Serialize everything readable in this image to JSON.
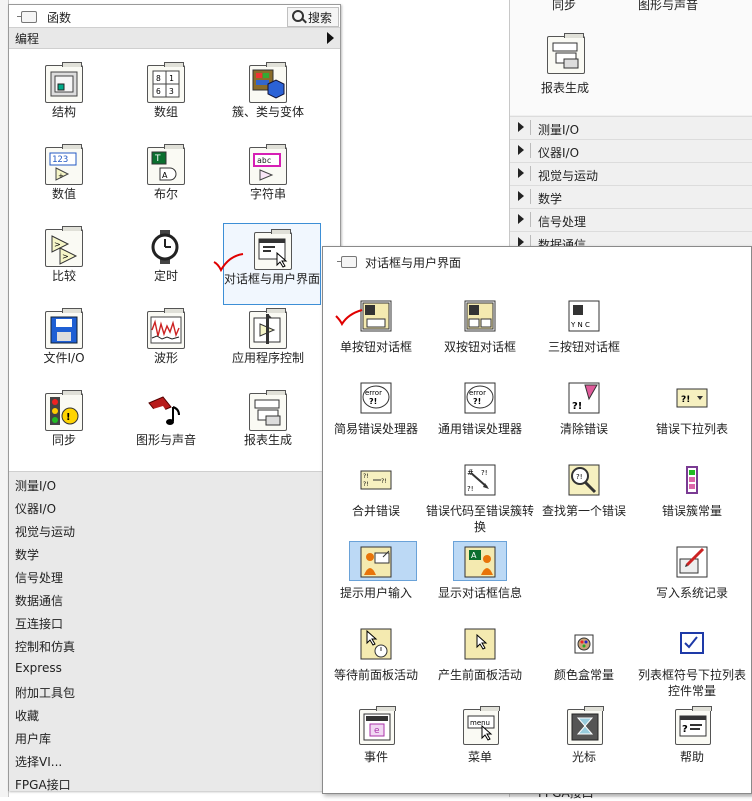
{
  "palette": {
    "title": "函数",
    "search_label": "搜索",
    "category": "编程",
    "items": [
      {
        "label": "结构",
        "icon": "structures-icon"
      },
      {
        "label": "数组",
        "icon": "array-icon"
      },
      {
        "label": "簇、类与变体",
        "icon": "cluster-class-variant-icon"
      },
      {
        "label": "数值",
        "icon": "numeric-icon"
      },
      {
        "label": "布尔",
        "icon": "boolean-icon"
      },
      {
        "label": "字符串",
        "icon": "string-icon"
      },
      {
        "label": "比较",
        "icon": "comparison-icon"
      },
      {
        "label": "定时",
        "icon": "timing-icon"
      },
      {
        "label": "对话框与用户界面",
        "icon": "dialog-ui-icon"
      },
      {
        "label": "文件I/O",
        "icon": "file-io-icon"
      },
      {
        "label": "波形",
        "icon": "waveform-icon"
      },
      {
        "label": "应用程序控制",
        "icon": "application-control-icon"
      },
      {
        "label": "同步",
        "icon": "synchronization-icon"
      },
      {
        "label": "图形与声音",
        "icon": "graphics-sound-icon"
      },
      {
        "label": "报表生成",
        "icon": "report-generation-icon"
      }
    ],
    "categories": [
      "测量I/O",
      "仪器I/O",
      "视觉与运动",
      "数学",
      "信号处理",
      "数据通信",
      "互连接口",
      "控制和仿真",
      "Express",
      "附加工具包",
      "收藏",
      "用户库",
      "选择VI...",
      "FPGA接口"
    ]
  },
  "background_panel": {
    "top_labels": [
      "同步",
      "图形与声音"
    ],
    "item_label": "报表生成",
    "categories": [
      "测量I/O",
      "仪器I/O",
      "视觉与运动",
      "数学",
      "信号处理",
      "数据通信"
    ],
    "bottom_label": "FPGA接口"
  },
  "popup": {
    "title": "对话框与用户界面",
    "items": [
      {
        "label": "单按钮对话框"
      },
      {
        "label": "双按钮对话框"
      },
      {
        "label": "三按钮对话框"
      },
      {
        "label": ""
      },
      {
        "label": "简易错误处理器"
      },
      {
        "label": "通用错误处理器"
      },
      {
        "label": "清除错误"
      },
      {
        "label": "错误下拉列表"
      },
      {
        "label": "合并错误"
      },
      {
        "label": "错误代码至错误簇转换"
      },
      {
        "label": "查找第一个错误"
      },
      {
        "label": "错误簇常量"
      },
      {
        "label": "提示用户输入"
      },
      {
        "label": "显示对话框信息"
      },
      {
        "label": ""
      },
      {
        "label": "写入系统记录"
      },
      {
        "label": "等待前面板活动"
      },
      {
        "label": "产生前面板活动"
      },
      {
        "label": "颜色盒常量"
      },
      {
        "label": "列表框符号下拉列表控件常量"
      },
      {
        "label": "事件"
      },
      {
        "label": "菜单"
      },
      {
        "label": "光标"
      },
      {
        "label": "帮助"
      }
    ]
  },
  "icon_text": {
    "numeric": "123",
    "boolean_t": "T",
    "boolean_a": "A",
    "string": "abc",
    "error": "error",
    "err_q": "?!",
    "menu": "menu",
    "yn": "Y N C",
    "e": "e"
  }
}
